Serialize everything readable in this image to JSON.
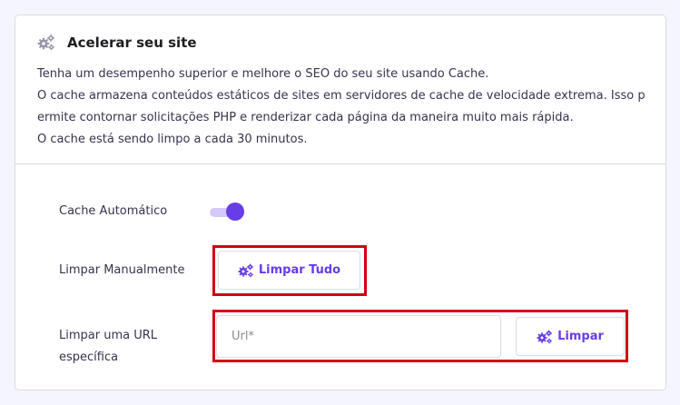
{
  "card": {
    "title": "Acelerar seu site",
    "title_icon": "gears-icon",
    "description": [
      "Tenha um desempenho superior e melhore o SEO do seu site usando Cache.",
      "O cache armazena conteúdos estáticos de sites em servidores de cache de velocidade extrema. Isso p",
      "ermite contornar solicitações PHP e renderizar cada página da maneira muito mais rápida.",
      "O cache está sendo limpo a cada 30 minutos."
    ]
  },
  "auto_cache": {
    "label": "Cache Automático",
    "enabled": true
  },
  "manual_clear": {
    "label": "Limpar Manualmente",
    "button_label": "Limpar Tudo",
    "button_icon": "gears-icon"
  },
  "url_clear": {
    "label_line1": "Limpar uma URL",
    "label_line2": "específica",
    "input_placeholder": "Url*",
    "input_value": "",
    "button_label": "Limpar",
    "button_icon": "gears-icon"
  },
  "colors": {
    "accent": "#673de6",
    "highlight": "#d10012",
    "toggle_track": "#d5c9fb",
    "page_background": "#f4f5ff"
  }
}
